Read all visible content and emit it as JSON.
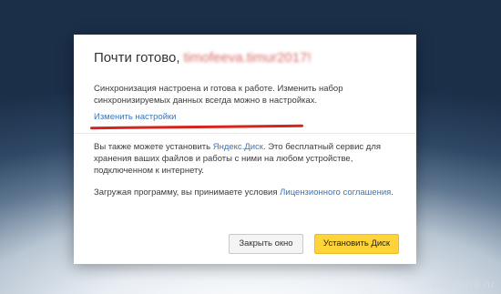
{
  "dialog": {
    "title_prefix": "Почти готово,",
    "title_name": "timofeeva.timur2017!",
    "sync_text": "Синхронизация настроена и готова к работе. Изменить набор синхронизируемых данных всегда можно в настройках.",
    "settings_link": "Изменить настройки",
    "disk_text_before": "Вы также можете установить ",
    "disk_link": "Яндекс.Диск",
    "disk_text_after": ". Это бесплатный сервис для хранения ваших файлов и работы с ними на любом устройстве, подключенном к интернету.",
    "license_text_before": "Загружая программу, вы принимаете условия ",
    "license_link": "Лицензионного соглашения",
    "license_text_after": ".",
    "close_button": "Закрыть окно",
    "install_button": "Установить Диск"
  },
  "watermark": "brauzerok.ru",
  "colors": {
    "link": "#3b74b8",
    "primary_button": "#ffd43b",
    "annotation_underline": "#d6241f"
  }
}
